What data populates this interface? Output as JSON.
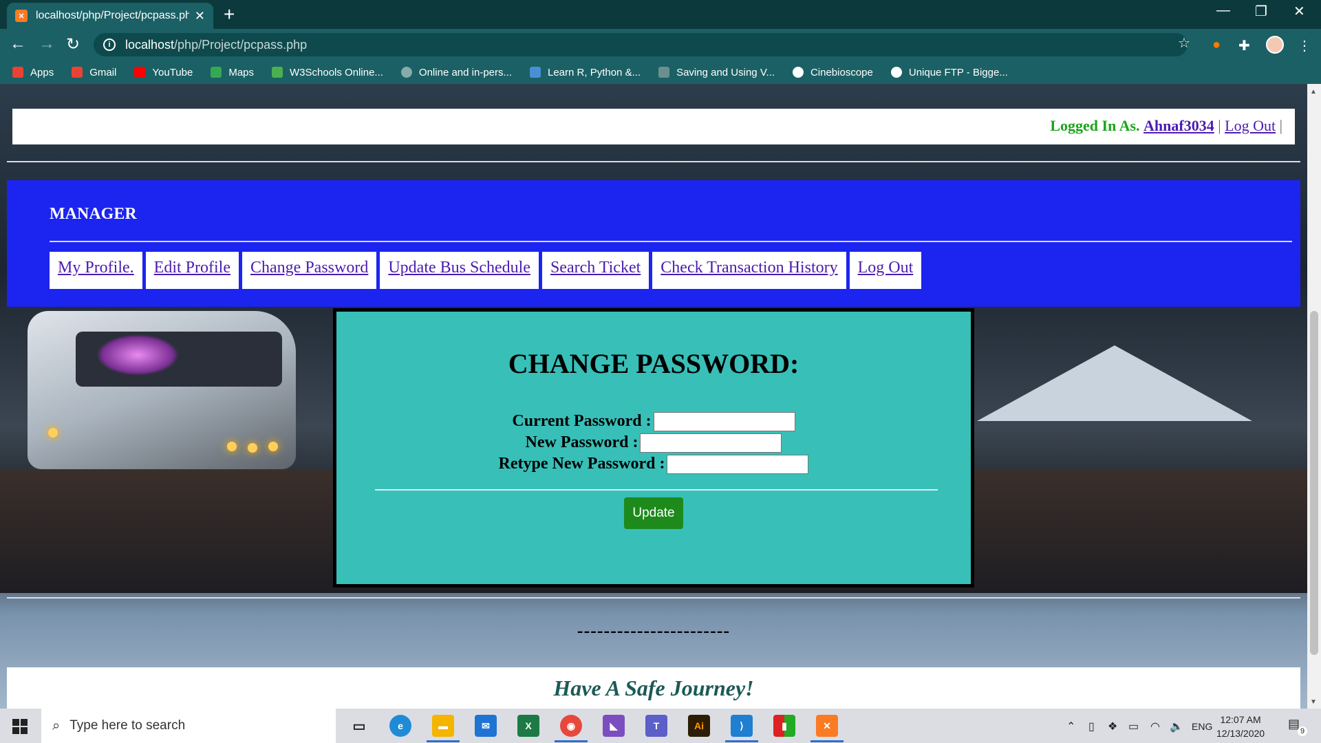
{
  "browser": {
    "tab_title": "localhost/php/Project/pcpass.php",
    "tab_favicon": "xampp-icon",
    "url_host": "localhost",
    "url_path": "/php/Project/pcpass.php",
    "bookmarks": [
      {
        "label": "Apps",
        "icon": "apps-grid-icon",
        "color": "#e94235"
      },
      {
        "label": "Gmail",
        "icon": "gmail-icon",
        "color": "#ea4335"
      },
      {
        "label": "YouTube",
        "icon": "youtube-icon",
        "color": "#ff0000"
      },
      {
        "label": "Maps",
        "icon": "maps-icon",
        "color": "#34a853"
      },
      {
        "label": "W3Schools Online...",
        "icon": "w3schools-icon",
        "color": "#4caf50"
      },
      {
        "label": "Online and in-pers...",
        "icon": "globe-icon",
        "color": "#8aa"
      },
      {
        "label": "Learn R, Python &...",
        "icon": "shield-icon",
        "color": "#4a8fd6"
      },
      {
        "label": "Saving and Using V...",
        "icon": "dash-icon",
        "color": "#6b8f8f"
      },
      {
        "label": "Cinebioscope",
        "icon": "globe-icon",
        "color": "#ffffff"
      },
      {
        "label": "Unique FTP - Bigge...",
        "icon": "globe-icon",
        "color": "#ffffff"
      }
    ]
  },
  "header": {
    "logged_in_label": "Logged In As.",
    "username": "Ahnaf3034",
    "logout_label": "Log Out"
  },
  "nav": {
    "role_title": "MANAGER",
    "items": [
      "My Profile.",
      "Edit Profile",
      "Change Password",
      "Update Bus Schedule",
      "Search Ticket",
      "Check Transaction History",
      "Log Out"
    ]
  },
  "form": {
    "title": "CHANGE PASSWORD:",
    "current_label": "Current Password :",
    "new_label": "New Password :",
    "retype_label": "Retype New Password :",
    "current_value": "",
    "new_value": "",
    "retype_value": "",
    "submit_label": "Update"
  },
  "footer": {
    "dashes": "-----------------------",
    "message": "Have A Safe Journey!"
  },
  "taskbar": {
    "search_placeholder": "Type here to search",
    "time": "12:07 AM",
    "date": "12/13/2020",
    "language": "ENG",
    "notification_count": "9"
  },
  "colors": {
    "nav_band": "#1c24f0",
    "card": "#38bfb8",
    "update_button": "#1d8a1b",
    "logged_in_text": "#1aa51a",
    "link": "#4b1bb0"
  }
}
